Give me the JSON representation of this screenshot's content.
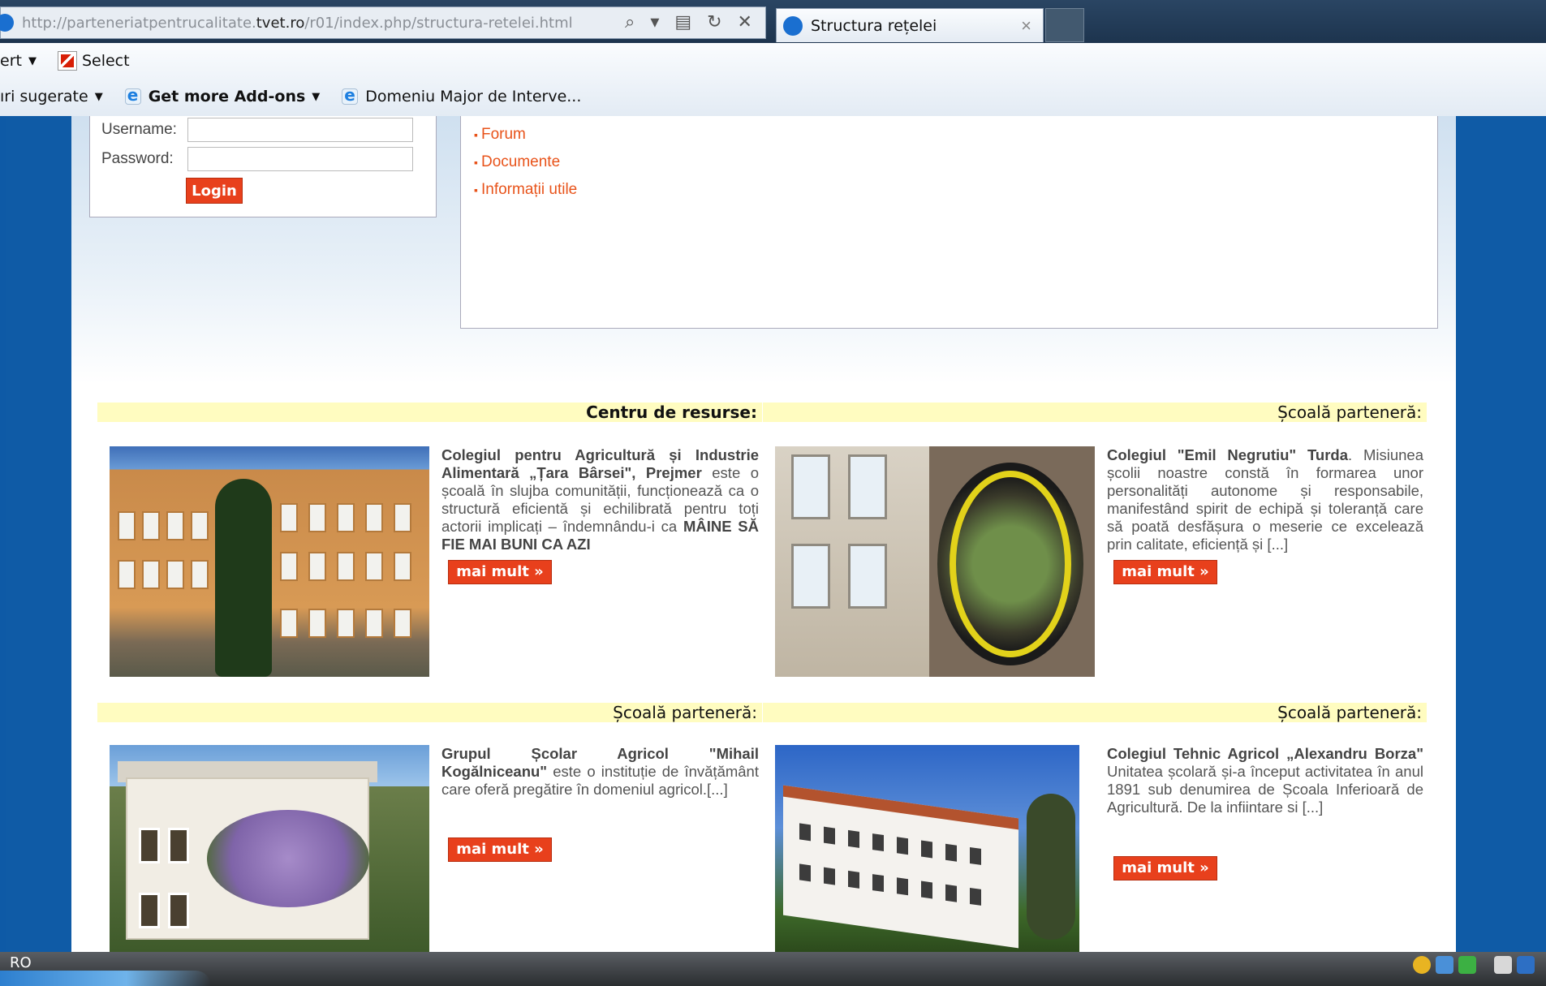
{
  "browser": {
    "url_prefix": "http://parteneriatpentrucalitate.",
    "url_domain": "tvet.ro",
    "url_suffix": "/r01/index.php/structura-retelei.html",
    "controls": "⌕ ▾ ▤ ↻ ✕",
    "tab_title": "Structura rețelei",
    "tab_close": "×"
  },
  "toolbar": {
    "row1": {
      "convert_label": "ert",
      "select_label": "Select"
    },
    "row2": {
      "suggested_label": "ıri sugerate",
      "addons_label": "Get more Add-ons",
      "domain_label": "Domeniu Major de Interve..."
    }
  },
  "login": {
    "username_label": "Username:",
    "password_label": "Password:",
    "username_value": "",
    "password_value": "",
    "button_label": "Login"
  },
  "menu": {
    "items": [
      "Forum",
      "Documente",
      "Informații utile"
    ]
  },
  "sections": [
    {
      "band": "Centru de resurse:",
      "title": "Colegiul pentru Agricultură și Industrie Alimentară „Țara Bârsei\", Prejmer",
      "text": " este o școală în slujba comunității, funcționează ca o structură eficientă și echilibrată pentru toți actorii implicați – îndemnându-i ca ",
      "tail": "MÂINE SĂ FIE MAI BUNI CA AZI",
      "more": "mai mult »"
    },
    {
      "band": "Școală parteneră:",
      "title": "Colegiul \"Emil Negrutiu\" Turda",
      "text": ". Misiunea școlii noastre constă în formarea unor personalități autonome și responsabile, manifestând spirit de echipă și toleranță care să poată desfășura o meserie ce excelează prin calitate, eficiență și [...]",
      "more": "mai mult »"
    },
    {
      "band": "Școală parteneră:",
      "title": "Grupul Școlar Agricol \"Mihail Kogălniceanu\"",
      "text": " este o instituție de învățământ care oferă pregătire în domeniul agricol.[...]",
      "more": "mai mult »"
    },
    {
      "band": "Școală parteneră:",
      "title": "Colegiul Tehnic Agricol „Alexandru Borza\"",
      "text": " Unitatea școlară și-a început activitatea în anul 1891 sub denumirea de Școala Inferioară de Agricultură. De la infiintare si [...]",
      "more": "mai mult »"
    }
  ],
  "taskbar": {
    "language": "RO"
  },
  "colors": {
    "accent": "#e8401c",
    "link": "#e8531a",
    "band": "#fffcc0",
    "page_bg": "#0f5ba6"
  }
}
